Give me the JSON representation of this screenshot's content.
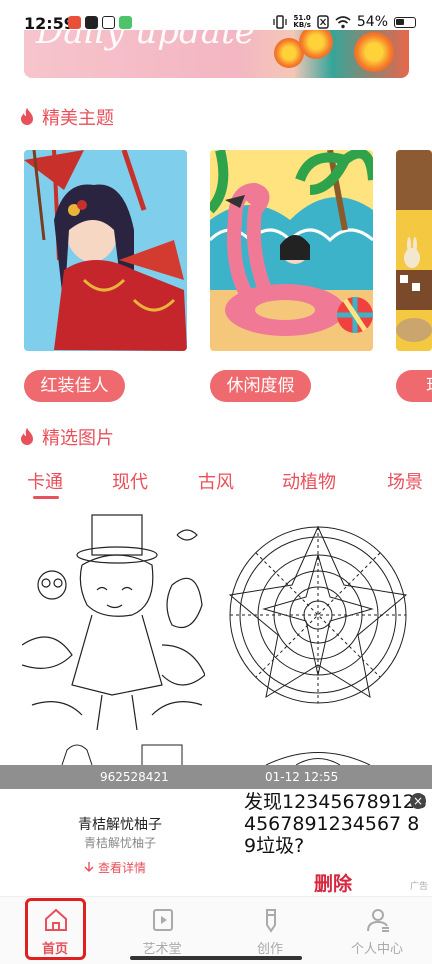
{
  "status_bar": {
    "time": "12:59",
    "net_speed_value": "51.0",
    "net_speed_unit": "KB/s",
    "battery_percent": "54%"
  },
  "banner": {
    "text": "Daily update"
  },
  "themes_section": {
    "title": "精美主题",
    "cards": [
      {
        "label": "红装佳人"
      },
      {
        "label": "休闲度假"
      },
      {
        "label": "现"
      }
    ]
  },
  "gallery_section": {
    "title": "精选图片",
    "tabs": [
      "卡通",
      "现代",
      "古风",
      "动植物",
      "场景"
    ],
    "active_tab": "卡通"
  },
  "ad": {
    "left_meta": "962528421",
    "right_meta": "01-12 12:55",
    "title": "青桔解忧柚子",
    "subtitle": "青桔解忧柚子",
    "link_label": "查看详情",
    "big_text": "发现1234567891234567891234567 89垃圾?",
    "delete_label": "删除",
    "close_symbol": "×",
    "ad_mark": "广告"
  },
  "bottom_nav": {
    "items": [
      {
        "label": "首页"
      },
      {
        "label": "艺术堂"
      },
      {
        "label": "创作"
      },
      {
        "label": "个人中心"
      }
    ],
    "active": "首页"
  },
  "colors": {
    "accent": "#e8505b",
    "tag_bg": "#ef6a6e",
    "highlight": "#e02020"
  }
}
